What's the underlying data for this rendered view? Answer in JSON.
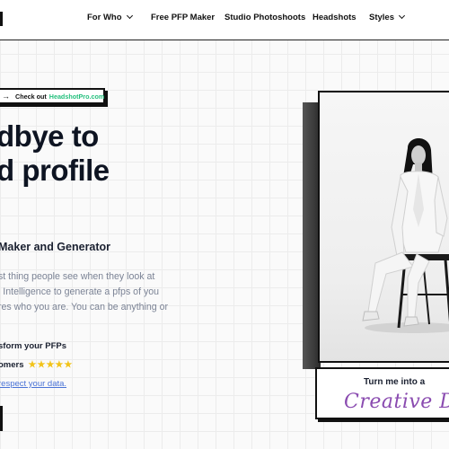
{
  "nav": {
    "items": [
      {
        "label": "For Who",
        "dropdown": true
      },
      {
        "label": "Free PFP Maker",
        "dropdown": false
      },
      {
        "label": "Studio Photoshoots",
        "dropdown": false
      },
      {
        "label": "Headshots",
        "dropdown": false
      },
      {
        "label": "Styles",
        "dropdown": true
      }
    ]
  },
  "hero": {
    "pill_prefix": "Check out",
    "pill_link": "HeadshotPro.com",
    "headline_line1": "dbye to",
    "headline_line2": "d profile",
    "subhead": "Maker and Generator",
    "body_lines": [
      "st thing people see when they look at",
      "l Intelligence to generate a pfps of you",
      "res who you are. You can be anything or"
    ],
    "transform_text": "sform your PFPs",
    "customers_text": "omers",
    "stars": "★★★★★",
    "privacy_link": "respect your data."
  },
  "card": {
    "caption_line1": "Turn me into a",
    "caption_line2": "Creative Dire"
  },
  "colors": {
    "accent_green": "#25c07e",
    "star_yellow": "#f2c318",
    "link_blue": "#4a73d6",
    "script_purple": "#8a4bb0"
  }
}
